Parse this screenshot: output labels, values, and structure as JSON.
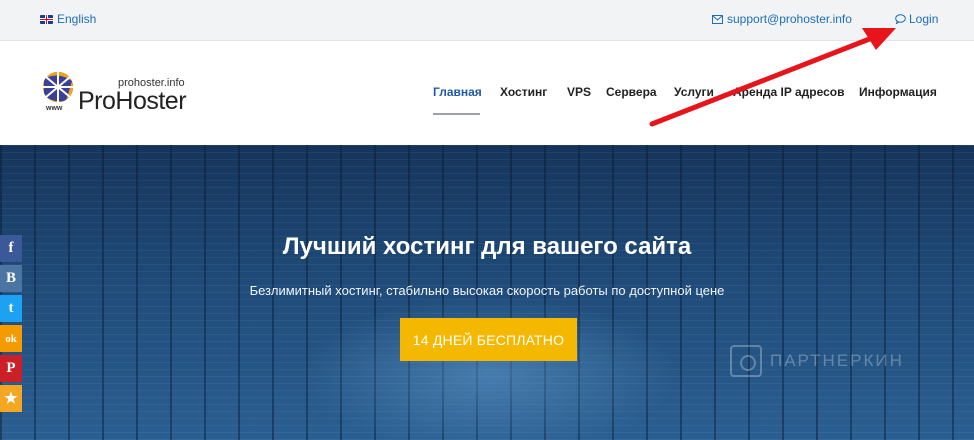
{
  "topbar": {
    "language": "English",
    "email": "support@prohoster.info",
    "login": "Login"
  },
  "logo": {
    "small": "prohoster.info",
    "big": "ProHoster",
    "www": "www"
  },
  "nav": {
    "items": [
      {
        "label": "Главная"
      },
      {
        "label": "Хостинг"
      },
      {
        "label": "VPS"
      },
      {
        "label": "Сервера"
      },
      {
        "label": "Услуги"
      },
      {
        "label": "Аренда IP адресов"
      },
      {
        "label": "Информация"
      }
    ]
  },
  "hero": {
    "title": "Лучший хостинг для вашего сайта",
    "subtitle": "Безлимитный хостинг, стабильно высокая скорость работы по доступной цене",
    "cta": "14 ДНЕЙ БЕСПЛАТНО",
    "watermark": "ПАРТНЕРКИН"
  },
  "social": [
    {
      "icon": "facebook-icon",
      "glyph": "f",
      "color": "#3b5998"
    },
    {
      "icon": "vk-icon",
      "glyph": "B",
      "color": "#4c75a3"
    },
    {
      "icon": "twitter-icon",
      "glyph": "t",
      "color": "#1da1f2"
    },
    {
      "icon": "odnoklassniki-icon",
      "glyph": "ok",
      "color": "#f59a00"
    },
    {
      "icon": "pinterest-icon",
      "glyph": "P",
      "color": "#cb2027"
    },
    {
      "icon": "favorite-icon",
      "glyph": "★",
      "color": "#f5a623"
    }
  ],
  "colors": {
    "accent": "#f5b800",
    "link": "#1e6fb8",
    "arrow": "#e8141c"
  }
}
